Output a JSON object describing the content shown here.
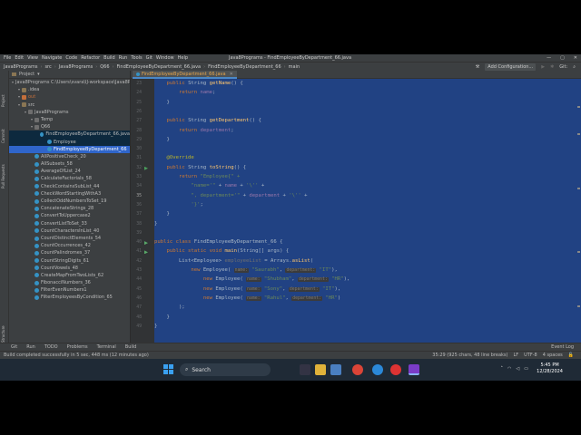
{
  "menu": [
    "File",
    "Edit",
    "View",
    "Navigate",
    "Code",
    "Refactor",
    "Build",
    "Run",
    "Tools",
    "Git",
    "Window",
    "Help"
  ],
  "window_title": "Java8Programs - FindEmployeeByDepartment_66.java",
  "breadcrumb": [
    "Java8Programs",
    "src",
    "Java8Programs",
    "Q66",
    "FindEmployeeByDepartment_66.java",
    "FindEmployeeByDepartment_66",
    "main"
  ],
  "toolbar": {
    "add_config": "Add Configuration..."
  },
  "side_tabs": [
    "Project",
    "Commit",
    "Pull Requests",
    "Structure",
    "Favorites"
  ],
  "project": {
    "header": "Project",
    "tree": [
      {
        "label": "Java8Programs  C:\\Users\\svara\\IJ-workspace\\Java8Programs",
        "indent": 0,
        "icon": "folder"
      },
      {
        "label": ".idea",
        "indent": 1,
        "icon": "folder"
      },
      {
        "label": "out",
        "indent": 1,
        "icon": "excl"
      },
      {
        "label": "src",
        "indent": 1,
        "icon": "folder"
      },
      {
        "label": "Java8Programs",
        "indent": 2,
        "icon": "pkg"
      },
      {
        "label": "Temp",
        "indent": 3,
        "icon": "pkg"
      },
      {
        "label": "Q66",
        "indent": 3,
        "icon": "pkg"
      },
      {
        "label": "FindEmployeeByDepartment_66.java",
        "indent": 4,
        "icon": "class",
        "state": "sel"
      },
      {
        "label": "Employee",
        "indent": 5,
        "icon": "class",
        "state": "sel"
      },
      {
        "label": "FindEmployeeByDepartment_66",
        "indent": 5,
        "icon": "class",
        "state": "hl"
      },
      {
        "label": "AllPositiveCheck_20",
        "indent": 3,
        "icon": "class"
      },
      {
        "label": "AllSubsets_58",
        "indent": 3,
        "icon": "class"
      },
      {
        "label": "AverageOfList_24",
        "indent": 3,
        "icon": "class"
      },
      {
        "label": "CalculateFactorials_58",
        "indent": 3,
        "icon": "class"
      },
      {
        "label": "CheckContainsSubList_44",
        "indent": 3,
        "icon": "class"
      },
      {
        "label": "CheckWordStartingWithA3",
        "indent": 3,
        "icon": "class"
      },
      {
        "label": "CollectOddNumbersToSet_19",
        "indent": 3,
        "icon": "class"
      },
      {
        "label": "ConcatenateStrings_28",
        "indent": 3,
        "icon": "class"
      },
      {
        "label": "ConvertToUppercase2",
        "indent": 3,
        "icon": "class"
      },
      {
        "label": "ConvertListToSet_33",
        "indent": 3,
        "icon": "class"
      },
      {
        "label": "CountCharactersInList_40",
        "indent": 3,
        "icon": "class"
      },
      {
        "label": "CountDistinctElements_54",
        "indent": 3,
        "icon": "class"
      },
      {
        "label": "CountOccurrences_42",
        "indent": 3,
        "icon": "class"
      },
      {
        "label": "CountPalindromes_37",
        "indent": 3,
        "icon": "class"
      },
      {
        "label": "CountStringDigits_61",
        "indent": 3,
        "icon": "class"
      },
      {
        "label": "CountVowels_48",
        "indent": 3,
        "icon": "class"
      },
      {
        "label": "CreateMapFromTwoLists_62",
        "indent": 3,
        "icon": "class"
      },
      {
        "label": "FibonacciNumbers_36",
        "indent": 3,
        "icon": "class"
      },
      {
        "label": "FilterEvenNumbers1",
        "indent": 3,
        "icon": "class"
      },
      {
        "label": "FilterEmployeesByCondition_65",
        "indent": 3,
        "icon": "class"
      }
    ]
  },
  "editor": {
    "tab": "FindEmployeeByDepartment_66.java",
    "current_line": "35",
    "line_numbers": [
      "23",
      "24",
      "25",
      "26",
      "27",
      "28",
      "29",
      "30",
      "31",
      "32",
      "33",
      "34",
      "35",
      "36",
      "37",
      "38",
      "39",
      "40",
      "41",
      "42",
      "43",
      "44",
      "45",
      "46",
      "47",
      "48",
      "49"
    ],
    "code_lines": [
      [
        {
          "t": "    "
        },
        {
          "t": "public ",
          "c": "kw"
        },
        {
          "t": "String "
        },
        {
          "t": "getName",
          "c": "fn"
        },
        {
          "t": "() {"
        }
      ],
      [
        {
          "t": "        "
        },
        {
          "t": "return ",
          "c": "kw"
        },
        {
          "t": "name",
          "c": "fd"
        },
        {
          "t": ";"
        }
      ],
      [
        {
          "t": "    }"
        }
      ],
      [
        {
          "t": ""
        }
      ],
      [
        {
          "t": "    "
        },
        {
          "t": "public ",
          "c": "kw"
        },
        {
          "t": "String "
        },
        {
          "t": "getDepartment",
          "c": "fn"
        },
        {
          "t": "() {"
        }
      ],
      [
        {
          "t": "        "
        },
        {
          "t": "return ",
          "c": "kw"
        },
        {
          "t": "department",
          "c": "fd"
        },
        {
          "t": ";"
        }
      ],
      [
        {
          "t": "    }"
        }
      ],
      [
        {
          "t": ""
        }
      ],
      [
        {
          "t": "    "
        },
        {
          "t": "@Override",
          "c": "an"
        }
      ],
      [
        {
          "t": "    "
        },
        {
          "t": "public ",
          "c": "kw"
        },
        {
          "t": "String "
        },
        {
          "t": "toString",
          "c": "fn"
        },
        {
          "t": "() {"
        }
      ],
      [
        {
          "t": "        "
        },
        {
          "t": "return ",
          "c": "kw"
        },
        {
          "t": "\"Employee{\" +",
          "c": "st"
        }
      ],
      [
        {
          "t": "            "
        },
        {
          "t": "\"name='\"",
          "c": "st"
        },
        {
          "t": " + "
        },
        {
          "t": "name",
          "c": "fd"
        },
        {
          "t": " + "
        },
        {
          "t": "'\\''",
          "c": "st"
        },
        {
          "t": " +"
        }
      ],
      [
        {
          "t": "            "
        },
        {
          "t": "\", department='\"",
          "c": "st"
        },
        {
          "t": " + "
        },
        {
          "t": "department",
          "c": "fd"
        },
        {
          "t": " + "
        },
        {
          "t": "'\\''",
          "c": "st"
        },
        {
          "t": " +"
        }
      ],
      [
        {
          "t": "            "
        },
        {
          "t": "'}'",
          "c": "st"
        },
        {
          "t": ";"
        }
      ],
      [
        {
          "t": "    }"
        }
      ],
      [
        {
          "t": "}"
        }
      ],
      [
        {
          "t": ""
        }
      ],
      [
        {
          "t": "public ",
          "c": "kw"
        },
        {
          "t": "class ",
          "c": "kw"
        },
        {
          "t": "FindEmployeeByDepartment_66 {"
        }
      ],
      [
        {
          "t": "    "
        },
        {
          "t": "public static void ",
          "c": "kw"
        },
        {
          "t": "main",
          "c": "fn"
        },
        {
          "t": "(String[] args) {"
        }
      ],
      [
        {
          "t": "        List<Employee> "
        },
        {
          "t": "employeeList",
          "c": "lv"
        },
        {
          "t": " = Arrays."
        },
        {
          "t": "asList",
          "c": "fn"
        },
        {
          "t": "("
        }
      ],
      [
        {
          "t": "            "
        },
        {
          "t": "new ",
          "c": "kw"
        },
        {
          "t": "Employee( "
        },
        {
          "t": "name:",
          "c": "pi"
        },
        {
          "t": " \"Saurabh\"",
          "c": "st"
        },
        {
          "t": ", "
        },
        {
          "t": "department:",
          "c": "pi"
        },
        {
          "t": " \"IT\"",
          "c": "st"
        },
        {
          "t": "),"
        }
      ],
      [
        {
          "t": "                "
        },
        {
          "t": "new ",
          "c": "kw"
        },
        {
          "t": "Employee( "
        },
        {
          "t": "name:",
          "c": "pi"
        },
        {
          "t": " \"Shubham\"",
          "c": "st"
        },
        {
          "t": ", "
        },
        {
          "t": "department:",
          "c": "pi"
        },
        {
          "t": " \"HR\"",
          "c": "st"
        },
        {
          "t": "),"
        }
      ],
      [
        {
          "t": "                "
        },
        {
          "t": "new ",
          "c": "kw"
        },
        {
          "t": "Employee( "
        },
        {
          "t": "name:",
          "c": "pi"
        },
        {
          "t": " \"Sony\"",
          "c": "st"
        },
        {
          "t": ", "
        },
        {
          "t": "department:",
          "c": "pi"
        },
        {
          "t": " \"IT\"",
          "c": "st"
        },
        {
          "t": "),"
        }
      ],
      [
        {
          "t": "                "
        },
        {
          "t": "new ",
          "c": "kw"
        },
        {
          "t": "Employee( "
        },
        {
          "t": "name:",
          "c": "pi"
        },
        {
          "t": " \"Rahul\"",
          "c": "st"
        },
        {
          "t": ", "
        },
        {
          "t": "department:",
          "c": "pi"
        },
        {
          "t": " \"HR\"",
          "c": "st"
        },
        {
          "t": ")"
        }
      ],
      [
        {
          "t": "        );"
        }
      ],
      [
        {
          "t": "    }"
        }
      ],
      [
        {
          "t": "}"
        }
      ]
    ]
  },
  "bottom_tools": [
    "Git",
    "Run",
    "TODO",
    "Problems",
    "Terminal",
    "Build"
  ],
  "event_log": "Event Log",
  "status": {
    "message": "Build completed successfully in 5 sec, 448 ms (12 minutes ago)",
    "position": "35:29 (925 chars, 48 line breaks)",
    "line_sep": "LF",
    "encoding": "UTF-8",
    "indent": "4 spaces"
  },
  "taskbar": {
    "search": "Search",
    "time": "5:45 PM",
    "date": "12/28/2024"
  },
  "colors": {
    "selection": "#214283",
    "editor_bg": "#2b2b2b",
    "panel_bg": "#3c3f41",
    "accent": "#4a88c7"
  }
}
